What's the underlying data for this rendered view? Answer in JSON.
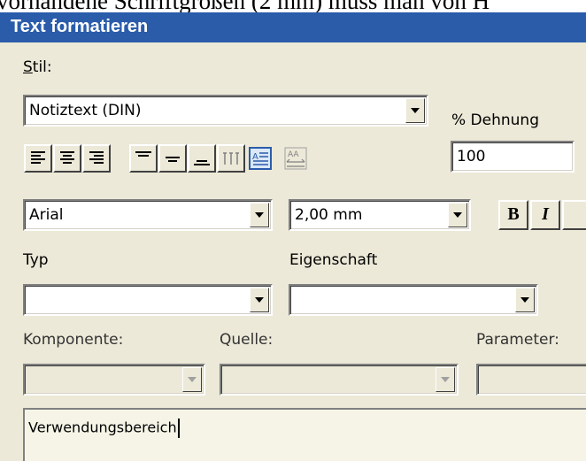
{
  "page_heading_cut": "vorhandene Schriftgrößen (2 mm) muss man von H",
  "window": {
    "title": "Text formatieren"
  },
  "stil": {
    "label": "Stil:",
    "value": "Notiztext (DIN)"
  },
  "dehnung": {
    "label": "% Dehnung",
    "value": "100"
  },
  "font": {
    "value": "Arial"
  },
  "size": {
    "value": "2,00 mm"
  },
  "style_buttons": {
    "bold": "B",
    "italic": "I"
  },
  "typ": {
    "label": "Typ",
    "value": ""
  },
  "eigenschaft": {
    "label": "Eigenschaft",
    "value": ""
  },
  "komponente": {
    "label": "Komponente:",
    "value": ""
  },
  "quelle": {
    "label": "Quelle:",
    "value": ""
  },
  "parameter": {
    "label": "Parameter:",
    "value": ""
  },
  "text_area": {
    "value": "Verwendungsbereich"
  },
  "icons": [
    "align-left-icon",
    "align-center-icon",
    "align-right-icon",
    "valign-top-icon",
    "valign-middle-icon",
    "valign-bottom-icon",
    "spacing-icon",
    "text-frame-icon",
    "fit-text-icon"
  ]
}
